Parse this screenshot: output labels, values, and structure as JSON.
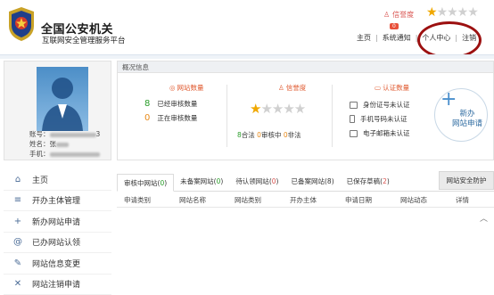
{
  "header": {
    "title": "全国公安机关",
    "subtitle": "互联网安全管理服务平台",
    "credit_label": "信誉度",
    "credit_stars": 1,
    "nav": [
      "主页",
      "系统通知",
      "个人中心",
      "注销"
    ],
    "notice_badge": "0"
  },
  "profile": {
    "account_label": "账号：",
    "account_tail": "3",
    "name_label": "姓名：",
    "name_value": "张",
    "phone_label": "手机："
  },
  "overview": {
    "title": "概况信息",
    "site_count_title": "网站数量",
    "filed_count": "8",
    "filed_label": "已经审核数量",
    "pending_count": "0",
    "pending_label": "正在审核数量",
    "credit_title": "信誉度",
    "credit_stars": 1,
    "legal_count": "8",
    "legal_label": "合法",
    "reviewing_count": "0",
    "reviewing_label": "审核中",
    "illegal_count": "0",
    "illegal_label": "非法",
    "auth_title": "认证数量",
    "auth_items": [
      "身份证号未认证",
      "手机号码未认证",
      "电子邮箱未认证"
    ],
    "apply_line1": "新办",
    "apply_line2": "网站申请"
  },
  "sidebar": {
    "items": [
      {
        "label": "主页",
        "icon": "home-icon"
      },
      {
        "label": "开办主体管理",
        "icon": "list-icon"
      },
      {
        "label": "新办网站申请",
        "icon": "plus-icon"
      },
      {
        "label": "已办网站认领",
        "icon": "at-icon"
      },
      {
        "label": "网站信息变更",
        "icon": "edit-icon"
      },
      {
        "label": "网站注销申请",
        "icon": "close-icon"
      }
    ]
  },
  "tabs": [
    {
      "label": "审核中网站",
      "count": "0",
      "color": "green"
    },
    {
      "label": "未备案网站",
      "count": "0",
      "color": "green"
    },
    {
      "label": "待认领网站",
      "count": "0",
      "color": "red"
    },
    {
      "label": "已备案网站",
      "count": "8",
      "color": "none"
    },
    {
      "label": "已保存草稿",
      "count": "2",
      "color": "red"
    }
  ],
  "tab_extra": "网站安全防护",
  "table_headers": [
    "申请类别",
    "网站名称",
    "网站类别",
    "开办主体",
    "申请日期",
    "网站动态",
    "详情"
  ],
  "colors": {
    "accent": "#2c6aa0",
    "green": "#2a9d2a",
    "orange": "#e88a1a",
    "red": "#d9534f"
  }
}
